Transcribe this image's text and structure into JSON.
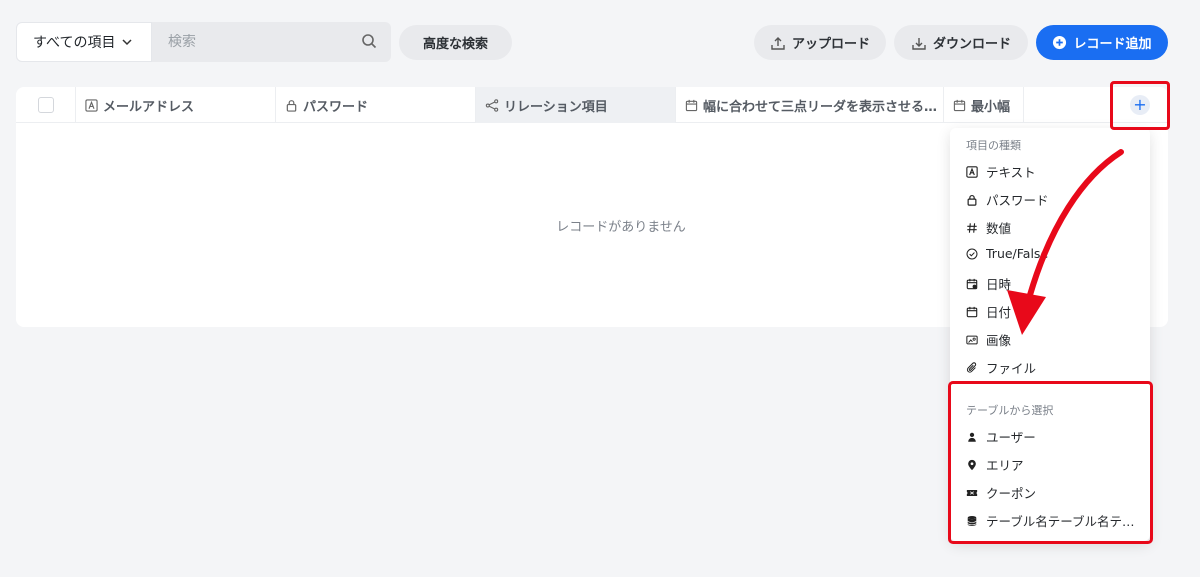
{
  "toolbar": {
    "scope_select": "すべての項目",
    "search_placeholder": "検索",
    "advanced_search": "高度な検索",
    "upload": "アップロード",
    "download": "ダウンロード",
    "add_record": "レコード追加"
  },
  "table": {
    "columns": [
      {
        "label": "メールアドレス",
        "icon": "text-a-icon"
      },
      {
        "label": "パスワード",
        "icon": "lock-icon"
      },
      {
        "label": "リレーション項目",
        "icon": "share-icon"
      },
      {
        "label": "幅に合わせて三点リーダを表示させる…",
        "icon": "calendar-icon"
      },
      {
        "label": "最小幅",
        "icon": "calendar-icon"
      }
    ],
    "empty_message": "レコードがありません"
  },
  "dropdown": {
    "field_types_heading": "項目の種類",
    "field_types": [
      {
        "label": "テキスト",
        "icon": "text-a-icon"
      },
      {
        "label": "パスワード",
        "icon": "lock-icon"
      },
      {
        "label": "数値",
        "icon": "hash-icon"
      },
      {
        "label": "True/False",
        "icon": "check-circle-icon"
      },
      {
        "label": "日時",
        "icon": "calendar-clock-icon"
      },
      {
        "label": "日付",
        "icon": "calendar-icon"
      },
      {
        "label": "画像",
        "icon": "image-icon"
      },
      {
        "label": "ファイル",
        "icon": "paperclip-icon"
      }
    ],
    "table_heading": "テーブルから選択",
    "tables": [
      {
        "label": "ユーザー",
        "icon": "user-icon"
      },
      {
        "label": "エリア",
        "icon": "map-pin-icon"
      },
      {
        "label": "クーポン",
        "icon": "ticket-icon"
      },
      {
        "label": "テーブル名テーブル名テ…",
        "icon": "database-icon"
      }
    ]
  },
  "colors": {
    "primary": "#1a6ef2",
    "highlight": "#e8091a"
  }
}
